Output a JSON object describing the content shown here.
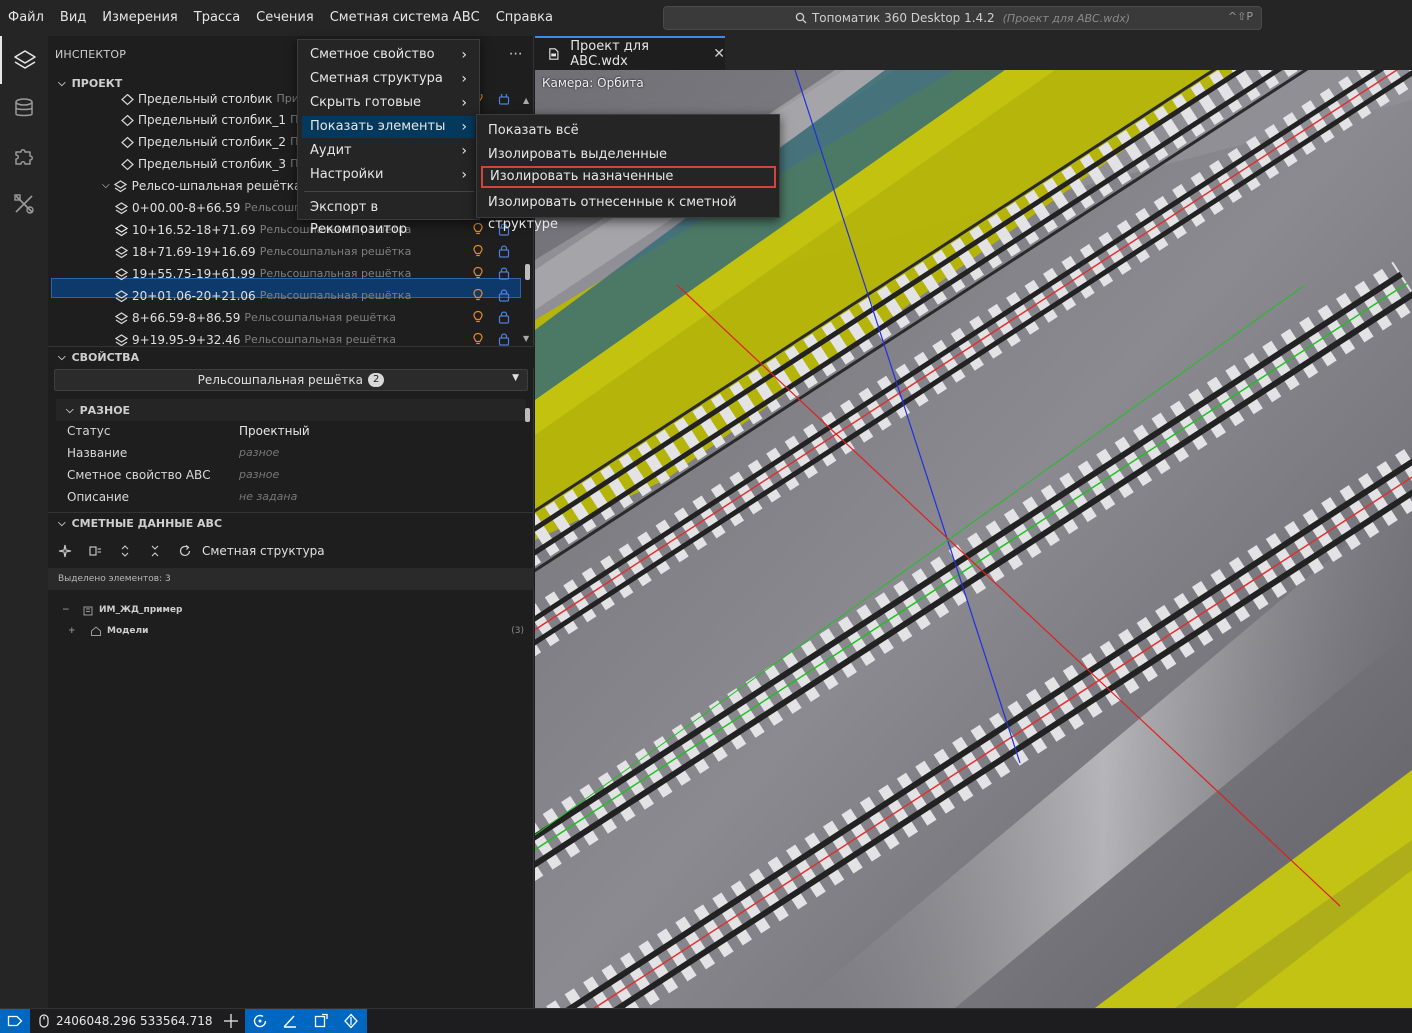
{
  "menubar": {
    "items": [
      "Файл",
      "Вид",
      "Измерения",
      "Трасса",
      "Сечения",
      "Сметная система АВС",
      "Справка"
    ]
  },
  "search": {
    "title": "Топоматик 360 Desktop 1.4.2",
    "project": "(Проект для АВС.wdx)",
    "shortcut": "^⇧P"
  },
  "inspector": {
    "title": "ИНСПЕКТОР",
    "project_section": "ПРОЕКТ",
    "tree": [
      {
        "label": "Предельный столбик",
        "sub": "При"
      },
      {
        "label": "Предельный столбик_1",
        "sub": "Пр"
      },
      {
        "label": "Предельный столбик_2",
        "sub": "Пр"
      },
      {
        "label": "Предельный столбик_3",
        "sub": "Пр"
      },
      {
        "label": "Рельсо-шпальная решётка",
        "sub": ""
      },
      {
        "label": "0+00.00-8+66.59",
        "sub": "Рельсошпа"
      },
      {
        "label": "10+16.52-18+71.69",
        "sub": "Рельсошпальная решётка"
      },
      {
        "label": "18+71.69-19+16.69",
        "sub": "Рельсошпальная решётка"
      },
      {
        "label": "19+55.75-19+61.99",
        "sub": "Рельсошпальная решётка"
      },
      {
        "label": "20+01.06-20+21.06",
        "sub": "Рельсошпальная решётка"
      },
      {
        "label": "8+66.59-8+86.59",
        "sub": "Рельсошпальная решётка"
      },
      {
        "label": "9+19.95-9+32.46",
        "sub": "Рельсошпальная решётка"
      }
    ],
    "properties_section": "СВОЙСТВА",
    "selector": {
      "label": "Рельсошпальная решётка",
      "count": "2"
    },
    "misc_section": "РАЗНОЕ",
    "props": [
      {
        "name": "Статус",
        "value": "Проектный"
      },
      {
        "name": "Название",
        "value": "разное"
      },
      {
        "name": "Сметное свойство АВС",
        "value": "разное"
      },
      {
        "name": "Описание",
        "value": "не задана"
      }
    ],
    "estimate_section": "СМЕТНЫЕ ДАННЫЕ АВС",
    "estimate_structure_label": "Сметная структура",
    "selected_info": "Выделено элементов: 3",
    "structure": [
      {
        "toggle": "−",
        "label": "ИМ_ЖД_пример",
        "count": ""
      },
      {
        "toggle": "+",
        "label": "Модели",
        "count": "(3)"
      }
    ]
  },
  "context_menu": {
    "items": [
      {
        "label": "Сметное свойство",
        "arrow": "›"
      },
      {
        "label": "Сметная структура",
        "arrow": "›"
      },
      {
        "label": "Скрыть готовые",
        "arrow": "›"
      },
      {
        "label": "Показать элементы",
        "arrow": "›"
      },
      {
        "label": "Аудит",
        "arrow": "›"
      },
      {
        "label": "Настройки",
        "arrow": "›"
      },
      {
        "label": "Экспорт в Рекомпозитор",
        "arrow": ""
      }
    ],
    "highlighted_index": 3
  },
  "submenu": {
    "items": [
      "Показать всё",
      "Изолировать выделенные",
      "Изолировать назначенные",
      "Изолировать отнесенные к сметной структуре"
    ],
    "boxed_index": 2
  },
  "editor": {
    "tab_title": "Проект для АВС.wdx",
    "close_glyph": "✕",
    "camera_label": "Камера: Орбита"
  },
  "statusbar": {
    "coords": "2406048.296 533564.718"
  },
  "colors": {
    "accent": "#0067c0",
    "selection": "#0d3a6b",
    "menu_highlight": "#04395e",
    "boxed_border": "#d0453b",
    "bulb": "#e08a2e",
    "lock": "#4f7fd8"
  }
}
